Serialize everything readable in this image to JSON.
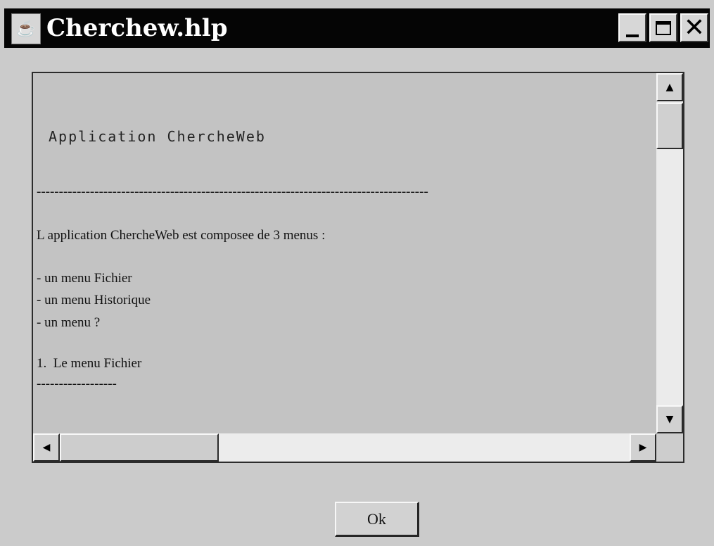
{
  "window": {
    "title": "Cherchew.hlp",
    "icon": "java-cup-icon",
    "controls": {
      "minimize": "minimize-icon",
      "maximize": "maximize-icon",
      "close": "close-icon"
    }
  },
  "help_text": {
    "heading": "Application ChercheWeb",
    "lines": [
      "----------------------------------------------------------------------------------------",
      "L application ChercheWeb est composee de 3 menus :",
      "- un menu Fichier",
      "- un menu Historique",
      "- un menu ?",
      "1.  Le menu Fichier",
      "------------------"
    ]
  },
  "scrollbars": {
    "up_arrow": "▲",
    "down_arrow": "▼",
    "left_arrow": "◀",
    "right_arrow": "▶"
  },
  "buttons": {
    "ok_label": "Ok"
  }
}
